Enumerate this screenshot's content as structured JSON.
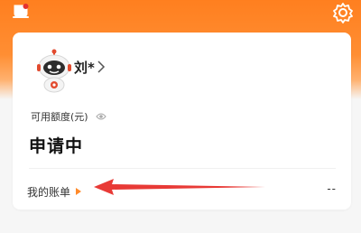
{
  "profile": {
    "name": "刘*"
  },
  "credit": {
    "label": "可用额度(元)",
    "status": "申请中"
  },
  "bill": {
    "label": "我的账单",
    "value": "--"
  },
  "icons": {
    "top_left": "bell-icon",
    "top_right": "gear-icon",
    "avatar": "robot-avatar",
    "visibility": "eye-icon",
    "profile_chevron": "chevron-right-icon",
    "bill_indicator": "triangle-right-icon",
    "annotation": "red-arrow"
  },
  "colors": {
    "brand_orange": "#ff7f1f",
    "annotation_red": "#e83a36"
  }
}
